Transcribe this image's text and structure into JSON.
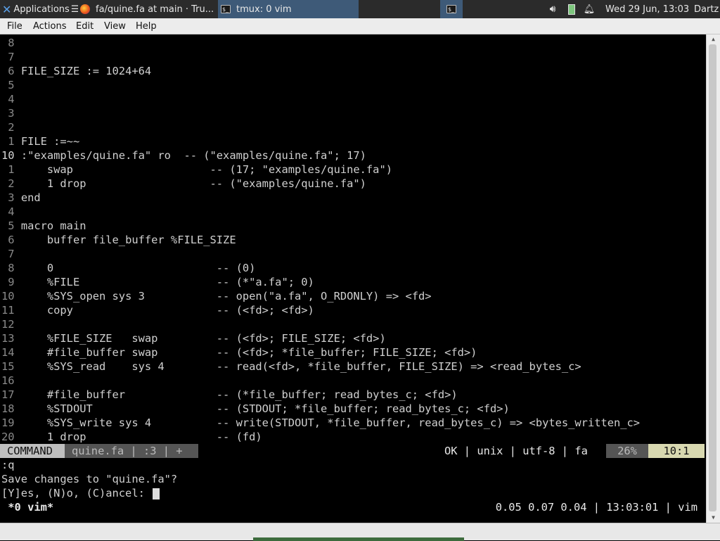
{
  "panel": {
    "applications": "Applications",
    "task1": "fa/quine.fa at main · Tru...",
    "task2": "tmux: 0 vim",
    "clock": "Wed 29 Jun, 13:03",
    "user": "Dartz"
  },
  "menu": [
    "File",
    "Actions",
    "Edit",
    "View",
    "Help"
  ],
  "editor": {
    "lines": [
      [
        "8",
        ""
      ],
      [
        "7",
        ""
      ],
      [
        "6",
        "FILE_SIZE := 1024+64"
      ],
      [
        "5",
        ""
      ],
      [
        "4",
        ""
      ],
      [
        "3",
        ""
      ],
      [
        "2",
        ""
      ],
      [
        "1",
        "FILE :=~~"
      ],
      [
        "10",
        ":\"examples/quine.fa\" ro  -- (\"examples/quine.fa\"; 17)"
      ],
      [
        "1",
        "    swap                     -- (17; \"examples/quine.fa\")"
      ],
      [
        "2",
        "    1 drop                   -- (\"examples/quine.fa\")"
      ],
      [
        "3",
        "end"
      ],
      [
        "4",
        ""
      ],
      [
        "5",
        "macro main"
      ],
      [
        "6",
        "    buffer file_buffer %FILE_SIZE"
      ],
      [
        "7",
        ""
      ],
      [
        "8",
        "    0                         -- (0)"
      ],
      [
        "9",
        "    %FILE                     -- (*\"a.fa\"; 0)"
      ],
      [
        "10",
        "    %SYS_open sys 3           -- open(\"a.fa\", O_RDONLY) => <fd>"
      ],
      [
        "11",
        "    copy                      -- (<fd>; <fd>)"
      ],
      [
        "12",
        ""
      ],
      [
        "13",
        "    %FILE_SIZE   swap         -- (<fd>; FILE_SIZE; <fd>)"
      ],
      [
        "14",
        "    #file_buffer swap         -- (<fd>; *file_buffer; FILE_SIZE; <fd>)"
      ],
      [
        "15",
        "    %SYS_read    sys 4        -- read(<fd>, *file_buffer, FILE_SIZE) => <read_bytes_c>"
      ],
      [
        "16",
        ""
      ],
      [
        "17",
        "    #file_buffer              -- (*file_buffer; read_bytes_c; <fd>)"
      ],
      [
        "18",
        "    %STDOUT                   -- (STDOUT; *file_buffer; read_bytes_c; <fd>)"
      ],
      [
        "19",
        "    %SYS_write sys 4          -- write(STDOUT, *file_buffer, read_bytes_c) => <bytes_written_c>"
      ],
      [
        "20",
        "    1 drop                    -- (fd)"
      ]
    ]
  },
  "status": {
    "mode": "COMMAND",
    "file": "quine.fa | :3 | +",
    "right": "OK | unix | utf-8 | fa",
    "percent": "26%",
    "position": "10:1"
  },
  "cmdline": {
    "line1": ":q",
    "line2": "Save changes to \"quine.fa\"?",
    "line3": "[Y]es, (N)o, (C)ancel: "
  },
  "tmux": {
    "left": " *0 vim*",
    "right": "0.05 0.07 0.04 | 13:03:01 | vim"
  }
}
